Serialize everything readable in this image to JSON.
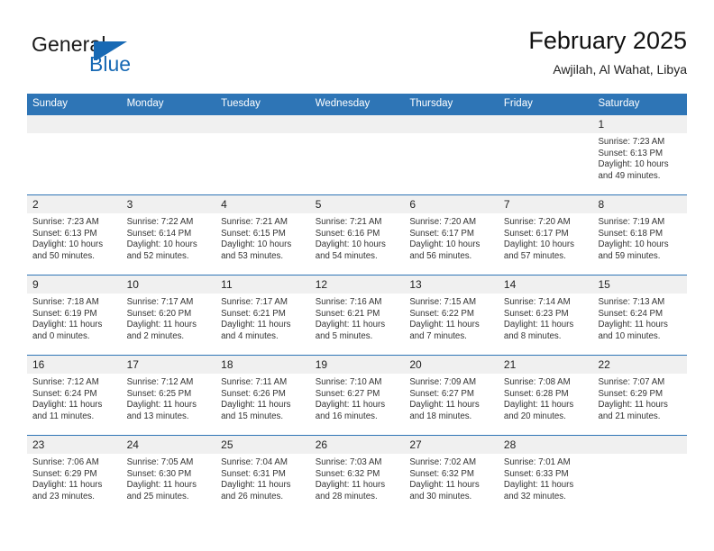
{
  "brand": {
    "name_part1": "General",
    "name_part2": "Blue",
    "accent_color": "#1769b4"
  },
  "header": {
    "title": "February 2025",
    "subtitle": "Awjilah, Al Wahat, Libya"
  },
  "theme": {
    "header_blue": "#2e75b6",
    "date_band": "#f0f0f0",
    "text": "#333333"
  },
  "weekdays": [
    "Sunday",
    "Monday",
    "Tuesday",
    "Wednesday",
    "Thursday",
    "Friday",
    "Saturday"
  ],
  "labels": {
    "sunrise": "Sunrise:",
    "sunset": "Sunset:",
    "daylight": "Daylight:"
  },
  "weeks": [
    {
      "days": [
        {
          "date": "",
          "sunrise": "",
          "sunset": "",
          "daylight_l1": "",
          "daylight_l2": ""
        },
        {
          "date": "",
          "sunrise": "",
          "sunset": "",
          "daylight_l1": "",
          "daylight_l2": ""
        },
        {
          "date": "",
          "sunrise": "",
          "sunset": "",
          "daylight_l1": "",
          "daylight_l2": ""
        },
        {
          "date": "",
          "sunrise": "",
          "sunset": "",
          "daylight_l1": "",
          "daylight_l2": ""
        },
        {
          "date": "",
          "sunrise": "",
          "sunset": "",
          "daylight_l1": "",
          "daylight_l2": ""
        },
        {
          "date": "",
          "sunrise": "",
          "sunset": "",
          "daylight_l1": "",
          "daylight_l2": ""
        },
        {
          "date": "1",
          "sunrise": "Sunrise: 7:23 AM",
          "sunset": "Sunset: 6:13 PM",
          "daylight_l1": "Daylight: 10 hours",
          "daylight_l2": "and 49 minutes."
        }
      ]
    },
    {
      "days": [
        {
          "date": "2",
          "sunrise": "Sunrise: 7:23 AM",
          "sunset": "Sunset: 6:13 PM",
          "daylight_l1": "Daylight: 10 hours",
          "daylight_l2": "and 50 minutes."
        },
        {
          "date": "3",
          "sunrise": "Sunrise: 7:22 AM",
          "sunset": "Sunset: 6:14 PM",
          "daylight_l1": "Daylight: 10 hours",
          "daylight_l2": "and 52 minutes."
        },
        {
          "date": "4",
          "sunrise": "Sunrise: 7:21 AM",
          "sunset": "Sunset: 6:15 PM",
          "daylight_l1": "Daylight: 10 hours",
          "daylight_l2": "and 53 minutes."
        },
        {
          "date": "5",
          "sunrise": "Sunrise: 7:21 AM",
          "sunset": "Sunset: 6:16 PM",
          "daylight_l1": "Daylight: 10 hours",
          "daylight_l2": "and 54 minutes."
        },
        {
          "date": "6",
          "sunrise": "Sunrise: 7:20 AM",
          "sunset": "Sunset: 6:17 PM",
          "daylight_l1": "Daylight: 10 hours",
          "daylight_l2": "and 56 minutes."
        },
        {
          "date": "7",
          "sunrise": "Sunrise: 7:20 AM",
          "sunset": "Sunset: 6:17 PM",
          "daylight_l1": "Daylight: 10 hours",
          "daylight_l2": "and 57 minutes."
        },
        {
          "date": "8",
          "sunrise": "Sunrise: 7:19 AM",
          "sunset": "Sunset: 6:18 PM",
          "daylight_l1": "Daylight: 10 hours",
          "daylight_l2": "and 59 minutes."
        }
      ]
    },
    {
      "days": [
        {
          "date": "9",
          "sunrise": "Sunrise: 7:18 AM",
          "sunset": "Sunset: 6:19 PM",
          "daylight_l1": "Daylight: 11 hours",
          "daylight_l2": "and 0 minutes."
        },
        {
          "date": "10",
          "sunrise": "Sunrise: 7:17 AM",
          "sunset": "Sunset: 6:20 PM",
          "daylight_l1": "Daylight: 11 hours",
          "daylight_l2": "and 2 minutes."
        },
        {
          "date": "11",
          "sunrise": "Sunrise: 7:17 AM",
          "sunset": "Sunset: 6:21 PM",
          "daylight_l1": "Daylight: 11 hours",
          "daylight_l2": "and 4 minutes."
        },
        {
          "date": "12",
          "sunrise": "Sunrise: 7:16 AM",
          "sunset": "Sunset: 6:21 PM",
          "daylight_l1": "Daylight: 11 hours",
          "daylight_l2": "and 5 minutes."
        },
        {
          "date": "13",
          "sunrise": "Sunrise: 7:15 AM",
          "sunset": "Sunset: 6:22 PM",
          "daylight_l1": "Daylight: 11 hours",
          "daylight_l2": "and 7 minutes."
        },
        {
          "date": "14",
          "sunrise": "Sunrise: 7:14 AM",
          "sunset": "Sunset: 6:23 PM",
          "daylight_l1": "Daylight: 11 hours",
          "daylight_l2": "and 8 minutes."
        },
        {
          "date": "15",
          "sunrise": "Sunrise: 7:13 AM",
          "sunset": "Sunset: 6:24 PM",
          "daylight_l1": "Daylight: 11 hours",
          "daylight_l2": "and 10 minutes."
        }
      ]
    },
    {
      "days": [
        {
          "date": "16",
          "sunrise": "Sunrise: 7:12 AM",
          "sunset": "Sunset: 6:24 PM",
          "daylight_l1": "Daylight: 11 hours",
          "daylight_l2": "and 11 minutes."
        },
        {
          "date": "17",
          "sunrise": "Sunrise: 7:12 AM",
          "sunset": "Sunset: 6:25 PM",
          "daylight_l1": "Daylight: 11 hours",
          "daylight_l2": "and 13 minutes."
        },
        {
          "date": "18",
          "sunrise": "Sunrise: 7:11 AM",
          "sunset": "Sunset: 6:26 PM",
          "daylight_l1": "Daylight: 11 hours",
          "daylight_l2": "and 15 minutes."
        },
        {
          "date": "19",
          "sunrise": "Sunrise: 7:10 AM",
          "sunset": "Sunset: 6:27 PM",
          "daylight_l1": "Daylight: 11 hours",
          "daylight_l2": "and 16 minutes."
        },
        {
          "date": "20",
          "sunrise": "Sunrise: 7:09 AM",
          "sunset": "Sunset: 6:27 PM",
          "daylight_l1": "Daylight: 11 hours",
          "daylight_l2": "and 18 minutes."
        },
        {
          "date": "21",
          "sunrise": "Sunrise: 7:08 AM",
          "sunset": "Sunset: 6:28 PM",
          "daylight_l1": "Daylight: 11 hours",
          "daylight_l2": "and 20 minutes."
        },
        {
          "date": "22",
          "sunrise": "Sunrise: 7:07 AM",
          "sunset": "Sunset: 6:29 PM",
          "daylight_l1": "Daylight: 11 hours",
          "daylight_l2": "and 21 minutes."
        }
      ]
    },
    {
      "days": [
        {
          "date": "23",
          "sunrise": "Sunrise: 7:06 AM",
          "sunset": "Sunset: 6:29 PM",
          "daylight_l1": "Daylight: 11 hours",
          "daylight_l2": "and 23 minutes."
        },
        {
          "date": "24",
          "sunrise": "Sunrise: 7:05 AM",
          "sunset": "Sunset: 6:30 PM",
          "daylight_l1": "Daylight: 11 hours",
          "daylight_l2": "and 25 minutes."
        },
        {
          "date": "25",
          "sunrise": "Sunrise: 7:04 AM",
          "sunset": "Sunset: 6:31 PM",
          "daylight_l1": "Daylight: 11 hours",
          "daylight_l2": "and 26 minutes."
        },
        {
          "date": "26",
          "sunrise": "Sunrise: 7:03 AM",
          "sunset": "Sunset: 6:32 PM",
          "daylight_l1": "Daylight: 11 hours",
          "daylight_l2": "and 28 minutes."
        },
        {
          "date": "27",
          "sunrise": "Sunrise: 7:02 AM",
          "sunset": "Sunset: 6:32 PM",
          "daylight_l1": "Daylight: 11 hours",
          "daylight_l2": "and 30 minutes."
        },
        {
          "date": "28",
          "sunrise": "Sunrise: 7:01 AM",
          "sunset": "Sunset: 6:33 PM",
          "daylight_l1": "Daylight: 11 hours",
          "daylight_l2": "and 32 minutes."
        },
        {
          "date": "",
          "sunrise": "",
          "sunset": "",
          "daylight_l1": "",
          "daylight_l2": ""
        }
      ]
    }
  ]
}
